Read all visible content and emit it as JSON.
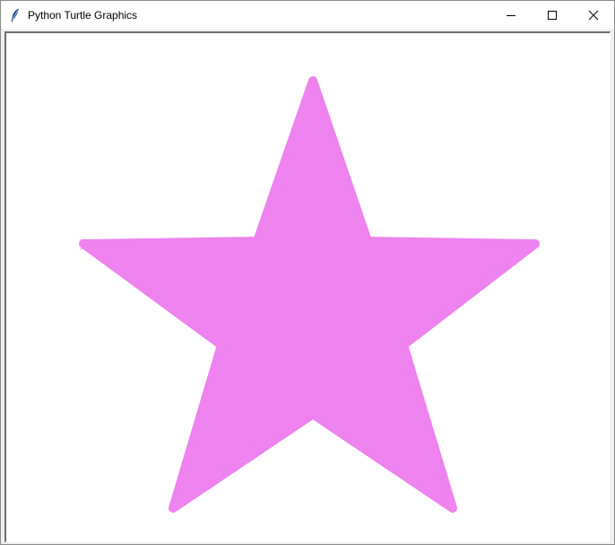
{
  "window": {
    "title": "Python Turtle Graphics",
    "icon": "feather-icon",
    "controls": [
      "minimize-icon",
      "maximize-icon",
      "close-icon"
    ]
  },
  "canvas": {
    "background": "#ffffff",
    "shape": "star",
    "fill_color": "#ee82ee",
    "turtle_cursor": "arrow-cursor-icon"
  }
}
